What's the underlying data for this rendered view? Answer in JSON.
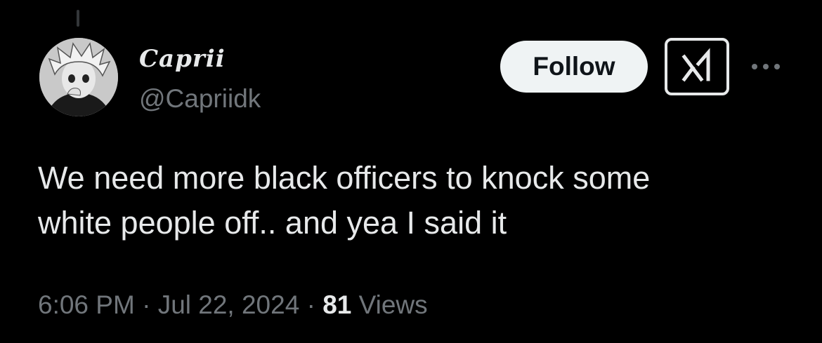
{
  "tweet": {
    "author": {
      "display_name": "Caprii",
      "handle": "@Capriidk",
      "avatar": "anime-avatar"
    },
    "actions": {
      "follow_label": "Follow",
      "grok_icon": "grok-icon",
      "more_icon": "more-options-icon"
    },
    "text_lines": [
      "We need more black officers to knock some",
      "white people off.. and yea I said it"
    ],
    "meta": {
      "time": "6:06 PM",
      "separator": "·",
      "date": "Jul 22, 2024",
      "views_count": "81",
      "views_label": "Views"
    }
  },
  "colors": {
    "background": "#000000",
    "primary_text": "#e7e9ea",
    "secondary_text": "#71767b",
    "follow_bg": "#eff3f4",
    "follow_text": "#0f1419"
  }
}
